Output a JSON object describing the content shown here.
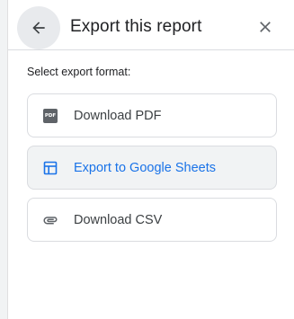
{
  "header": {
    "title": "Export this report",
    "back_icon": "arrow-left-icon",
    "close_icon": "close-icon"
  },
  "section_label": "Select export format:",
  "options": [
    {
      "label": "Download PDF",
      "icon": "pdf-file-icon",
      "icon_text": "PDF",
      "selected": false
    },
    {
      "label": "Export to Google Sheets",
      "icon": "sheets-table-icon",
      "selected": true
    },
    {
      "label": "Download CSV",
      "icon": "paperclip-icon",
      "selected": false
    }
  ],
  "colors": {
    "accent": "#1a73e8",
    "text": "#202124",
    "muted_text": "#3c4043",
    "icon_gray": "#5f6368",
    "border": "#dadce0",
    "selected_bg": "#f1f3f4"
  }
}
